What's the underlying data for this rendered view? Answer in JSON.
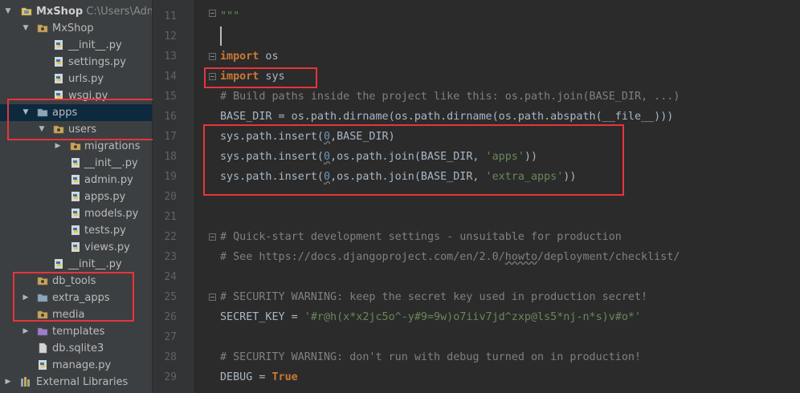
{
  "colors": {
    "tree_bg": "#3c3f41",
    "editor_bg": "#2b2b2b",
    "selection": "#0d293e",
    "highlight_box": "#e8343a",
    "keyword": "#cc7832",
    "comment": "#808080",
    "string": "#6a8759",
    "number": "#6897bb"
  },
  "tree": {
    "root_name": "MxShop",
    "root_path": "C:\\Users\\Admi",
    "mxshop_folder": "MxShop",
    "init_py_1": "__init__.py",
    "settings_py": "settings.py",
    "urls_py": "urls.py",
    "wsgi_py": "wsgi.py",
    "apps": "apps",
    "users": "users",
    "migrations": "migrations",
    "init_py_2": "__init__.py",
    "admin_py": "admin.py",
    "apps_py": "apps.py",
    "models_py": "models.py",
    "tests_py": "tests.py",
    "views_py": "views.py",
    "init_py_3": "__init__.py",
    "db_tools": "db_tools",
    "extra_apps": "extra_apps",
    "media": "media",
    "templates": "templates",
    "db_sqlite3": "db.sqlite3",
    "manage_py": "manage.py",
    "external_libraries": "External Libraries"
  },
  "editor": {
    "line_numbers": [
      "11",
      "12",
      "13",
      "14",
      "15",
      "16",
      "17",
      "18",
      "19",
      "20",
      "21",
      "22",
      "23",
      "24",
      "25",
      "26",
      "27",
      "28",
      "29"
    ],
    "l11_docstring": "\"\"\"",
    "l13_kw": "import",
    "l13_mod": " os",
    "l14_kw": "import",
    "l14_mod": " sys",
    "l15_comment": "# Build paths inside the project like this: os.path.join(BASE_DIR, ...)",
    "l16_code": "BASE_DIR = os.path.dirname(os.path.dirname(os.path.abspath(__file__)))",
    "l17_a": "sys.path.insert(",
    "l17_num": "0",
    "l17_b": ",BASE_DIR)",
    "l18_a": "sys.path.insert(",
    "l18_num": "0",
    "l18_b": ",os.path.join(BASE_DIR, ",
    "l18_str": "'apps'",
    "l18_c": "))",
    "l19_a": "sys.path.insert(",
    "l19_num": "0",
    "l19_b": ",os.path.join(BASE_DIR, ",
    "l19_str": "'extra_apps'",
    "l19_c": "))",
    "l22_comment": "# Quick-start development settings - unsuitable for production",
    "l23_comment_a": "# See https://docs.djangoproject.com/en/2.0/",
    "l23_comment_b": "howto",
    "l23_comment_c": "/deployment/checklist/",
    "l25_comment": "# SECURITY WARNING: keep the secret key used in production secret!",
    "l26_a": "SECRET_KEY = ",
    "l26_str": "'#r@h(x*x2jc5o^-y#9=9w)o7iiv7jd^zxp@ls5*nj-n*s)v#o*'",
    "l28_comment": "# SECURITY WARNING: don't run with debug turned on in production!",
    "l29_a": "DEBUG = ",
    "l29_kw": "True"
  }
}
